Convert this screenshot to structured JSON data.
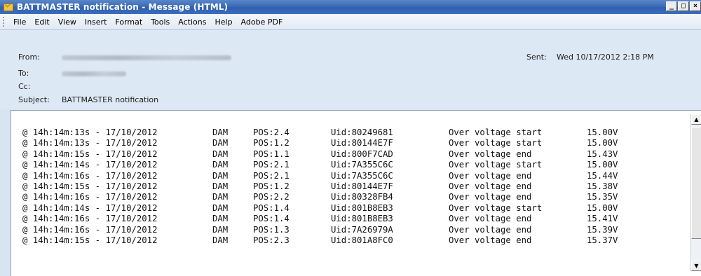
{
  "window": {
    "title": "BATTMASTER notification - Message (HTML)",
    "controls": [
      "_",
      "□",
      "×"
    ]
  },
  "menu": [
    {
      "label": "File",
      "key": "F"
    },
    {
      "label": "Edit",
      "key": "E"
    },
    {
      "label": "View",
      "key": "V"
    },
    {
      "label": "Insert",
      "key": "I"
    },
    {
      "label": "Format",
      "key": "o"
    },
    {
      "label": "Tools",
      "key": "T"
    },
    {
      "label": "Actions",
      "key": "A"
    },
    {
      "label": "Help",
      "key": "H"
    },
    {
      "label": "Adobe PDF",
      "key": "P"
    }
  ],
  "header": {
    "from_label": "From:",
    "to_label": "To:",
    "cc_label": "Cc:",
    "subject_label": "Subject:",
    "subject_value": "BATTMASTER notification",
    "sent_label": "Sent:",
    "sent_value": "Wed 10/17/2012 2:18 PM"
  },
  "message_lines": [
    {
      "time": "@ 14h:14m:13s - 17/10/2012",
      "source": "DAM",
      "pos": "POS:2.4",
      "uid": "Uid:80249681",
      "event": "Over voltage start",
      "voltage": "15.00V"
    },
    {
      "time": "@ 14h:14m:13s - 17/10/2012",
      "source": "DAM",
      "pos": "POS:1.2",
      "uid": "Uid:80144E7F",
      "event": "Over voltage start",
      "voltage": "15.00V"
    },
    {
      "time": "@ 14h:14m:15s - 17/10/2012",
      "source": "DAM",
      "pos": "POS:1.1",
      "uid": "Uid:800F7CAD",
      "event": "Over voltage end",
      "voltage": "15.43V"
    },
    {
      "time": "@ 14h:14m:14s - 17/10/2012",
      "source": "DAM",
      "pos": "POS:2.1",
      "uid": "Uid:7A355C6C",
      "event": "Over voltage start",
      "voltage": "15.00V"
    },
    {
      "time": "@ 14h:14m:16s - 17/10/2012",
      "source": "DAM",
      "pos": "POS:2.1",
      "uid": "Uid:7A355C6C",
      "event": "Over voltage end",
      "voltage": "15.44V"
    },
    {
      "time": "@ 14h:14m:15s - 17/10/2012",
      "source": "DAM",
      "pos": "POS:1.2",
      "uid": "Uid:80144E7F",
      "event": "Over voltage end",
      "voltage": "15.38V"
    },
    {
      "time": "@ 14h:14m:16s - 17/10/2012",
      "source": "DAM",
      "pos": "POS:2.2",
      "uid": "Uid:80328FB4",
      "event": "Over voltage end",
      "voltage": "15.35V"
    },
    {
      "time": "@ 14h:14m:14s - 17/10/2012",
      "source": "DAM",
      "pos": "POS:1.4",
      "uid": "Uid:801B8EB3",
      "event": "Over voltage start",
      "voltage": "15.00V"
    },
    {
      "time": "@ 14h:14m:16s - 17/10/2012",
      "source": "DAM",
      "pos": "POS:1.4",
      "uid": "Uid:801B8EB3",
      "event": "Over voltage end",
      "voltage": "15.41V"
    },
    {
      "time": "@ 14h:14m:16s - 17/10/2012",
      "source": "DAM",
      "pos": "POS:1.3",
      "uid": "Uid:7A26979A",
      "event": "Over voltage end",
      "voltage": "15.39V"
    },
    {
      "time": "@ 14h:14m:15s - 17/10/2012",
      "source": "DAM",
      "pos": "POS:2.3",
      "uid": "Uid:801A8FC0",
      "event": "Over voltage end",
      "voltage": "15.37V"
    }
  ],
  "icons": {
    "title": "envelope-icon",
    "scroll_up": "arrow-up-icon",
    "scroll_down": "arrow-down-icon"
  },
  "colors": {
    "titlebar": "#3c6bb8",
    "header_bg": "#dde8f5",
    "menubar_bg": "#e3eaf4"
  }
}
